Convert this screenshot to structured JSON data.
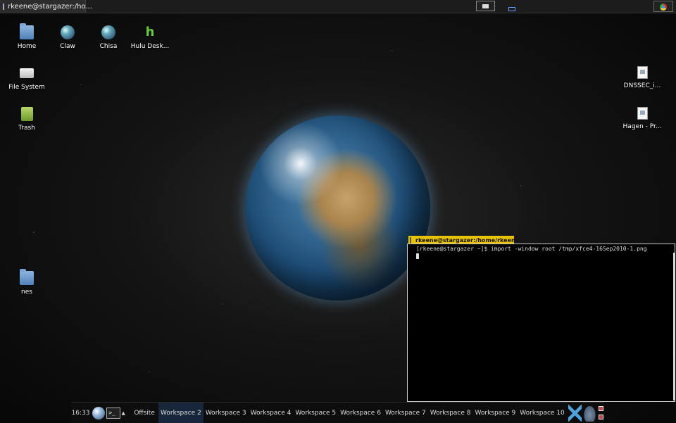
{
  "top_panel": {
    "task_button_label": "rkeene@stargazer:/ho..."
  },
  "desktop_icons": [
    {
      "label": "Home",
      "icon": "home-folder-icon"
    },
    {
      "label": "Claw",
      "icon": "network-globe-icon"
    },
    {
      "label": "Chisa",
      "icon": "network-globe-icon"
    },
    {
      "label": "Hulu Desk...",
      "icon": "hulu-icon"
    },
    {
      "label": "File System",
      "icon": "drive-icon"
    },
    {
      "label": "Trash",
      "icon": "trash-icon"
    },
    {
      "label": "nes",
      "icon": "folder-icon"
    },
    {
      "label": "DNSSEC_i...",
      "icon": "document-icon"
    },
    {
      "label": "Hagen - Pr...",
      "icon": "document-icon"
    }
  ],
  "terminal": {
    "title": "rkeene@stargazer:/home/rkeene",
    "command_line": "[rkeene@stargazer ~]$ import -window root /tmp/xfce4-16Sep2010-1.png"
  },
  "bottom_panel": {
    "clock": "16:33",
    "offsite_label": "Offsite",
    "workspaces": [
      "Workspace 2",
      "Workspace 3",
      "Workspace 4",
      "Workspace 5",
      "Workspace 6",
      "Workspace 7",
      "Workspace 8",
      "Workspace 9",
      "Workspace 10"
    ],
    "active_workspace": "Workspace 2"
  },
  "colors": {
    "terminal_title_bg": "#e8c300",
    "active_workspace_bg": "#17263a",
    "hulu_green": "#66cc33"
  }
}
